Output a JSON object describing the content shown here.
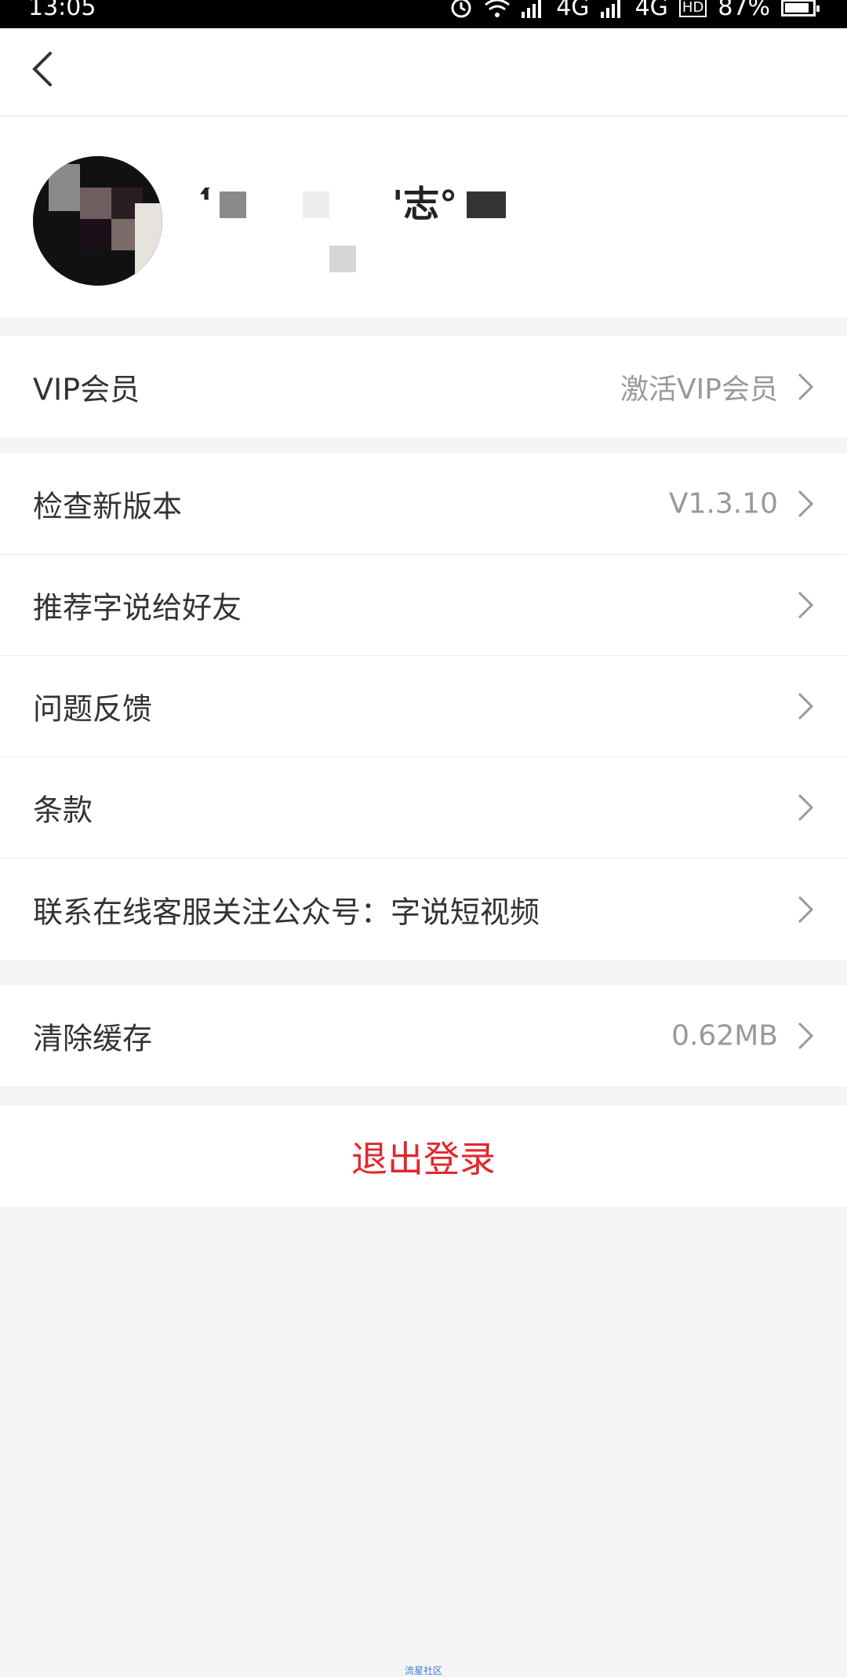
{
  "status_bar": {
    "time": "13:05",
    "network_1": "4G",
    "network_2": "4G",
    "hd": "HD",
    "battery": "87%",
    "battery_fraction": 0.87
  },
  "profile": {
    "username": "'́　　　　　'志°"
  },
  "vip": {
    "label": "VIP会员",
    "value": "激活VIP会员"
  },
  "menu": [
    {
      "label": "检查新版本",
      "value": "V1.3.10"
    },
    {
      "label": "推荐字说给好友",
      "value": ""
    },
    {
      "label": "问题反馈",
      "value": ""
    },
    {
      "label": "条款",
      "value": ""
    },
    {
      "label": "联系在线客服关注公众号：字说短视频",
      "value": ""
    }
  ],
  "cache": {
    "label": "清除缓存",
    "value": "0.62MB"
  },
  "logout": {
    "label": "退出登录"
  },
  "footer": {
    "tag": "流星社区"
  },
  "colors": {
    "logout_red": "#e0282d",
    "value_gray": "#999999"
  }
}
